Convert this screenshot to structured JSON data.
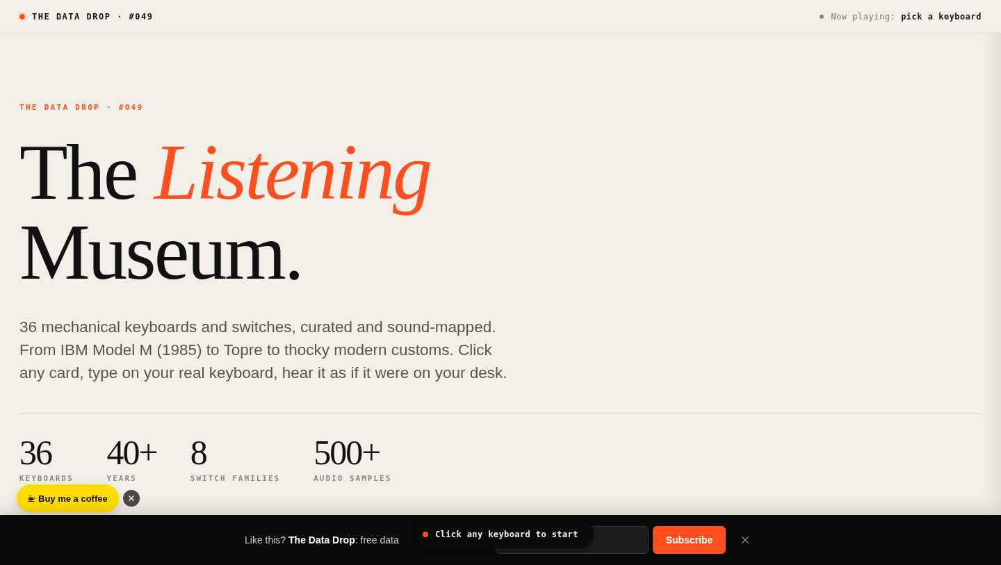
{
  "top_bar": {
    "brand": "THE DATA DROP · #049",
    "now_playing": {
      "label": "Now playing:",
      "value": "pick a keyboard"
    }
  },
  "hero": {
    "eyebrow": "THE DATA DROP · #049",
    "title": "The *Listening* Museum.",
    "intro": "36 mechanical keyboards and switches, curated and sound-mapped. From IBM Model M (1985) to Topre to thocky modern customs. Click any card, type on your real keyboard, hear it as if it were on your desk."
  },
  "stats": [
    {
      "value": "36",
      "label": "KEYBOARDS"
    },
    {
      "value": "40+",
      "label": "YEARS"
    },
    {
      "value": "8",
      "label": "SWITCH FAMILIES"
    },
    {
      "value": "500+",
      "label": "AUDIO SAMPLES"
    }
  ],
  "coffee_button": {
    "label": "Buy me a coffee"
  },
  "subscribe_bar": {
    "text": "Like this? **The Data Drop**: free data",
    "button": "Subscribe"
  },
  "toast": {
    "text": "Click any keyboard to start"
  }
}
